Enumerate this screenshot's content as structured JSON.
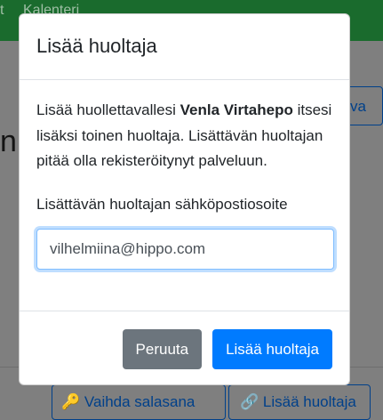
{
  "background": {
    "nav_fragment_left": "t",
    "nav_fragment_calendar": "Kalenteri",
    "heading_fragment": "ni",
    "top_right_button_fragment": "va",
    "change_password_button": "Vaihda salasana",
    "add_guardian_button": "Lisää huoltaja"
  },
  "modal": {
    "title": "Lisää huoltaja",
    "info_before": "Lisää huollettavallesi ",
    "child_name": "Venla Virtahepo",
    "info_after": " itsesi lisäksi toinen huoltaja. Lisättävän huoltajan pitää olla rekisteröitynyt palveluun.",
    "email_label": "Lisättävän huoltajan sähköpostiosoite",
    "email_value": "vilhelmiina@hippo.com",
    "cancel_label": "Peruuta",
    "submit_label": "Lisää huoltaja"
  },
  "colors": {
    "primary": "#007bff",
    "secondary": "#6c757d",
    "navbar": "#28a745"
  }
}
